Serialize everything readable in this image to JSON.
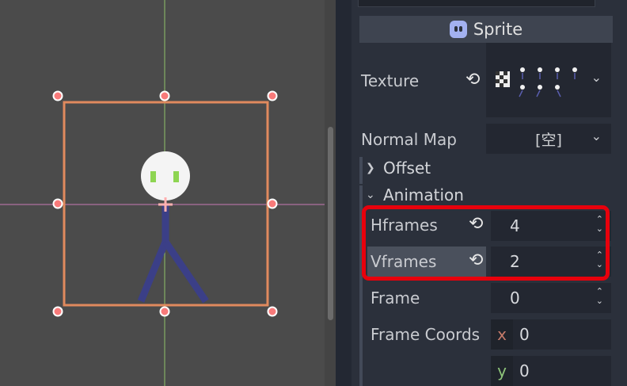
{
  "inspector": {
    "section_title": "Sprite",
    "texture_label": "Texture",
    "normal_map_label": "Normal Map",
    "normal_map_value": "[空]",
    "offset_label": "Offset",
    "animation_label": "Animation",
    "hframes_label": "Hframes",
    "hframes_value": "4",
    "vframes_label": "Vframes",
    "vframes_value": "2",
    "frame_label": "Frame",
    "frame_value": "0",
    "frame_coords_label": "Frame Coords",
    "frame_coords_x_axis": "x",
    "frame_coords_x": "0",
    "frame_coords_y_axis": "y",
    "frame_coords_y": "0"
  },
  "icons": [
    "sprite-node-icon",
    "revert-icon",
    "checker-texture-icon",
    "chevron-down-icon",
    "chevron-right-icon",
    "spin-arrows-icon"
  ],
  "colors": {
    "selection_box": "#e08a5e",
    "handle_fill": "#f87a7a",
    "highlight_box": "#e8000c",
    "stick_figure_body": "#3b3f87",
    "stick_figure_eyes": "#8ed552",
    "inspector_bg": "#2b303b",
    "viewport_bg": "#4b4b4b"
  }
}
